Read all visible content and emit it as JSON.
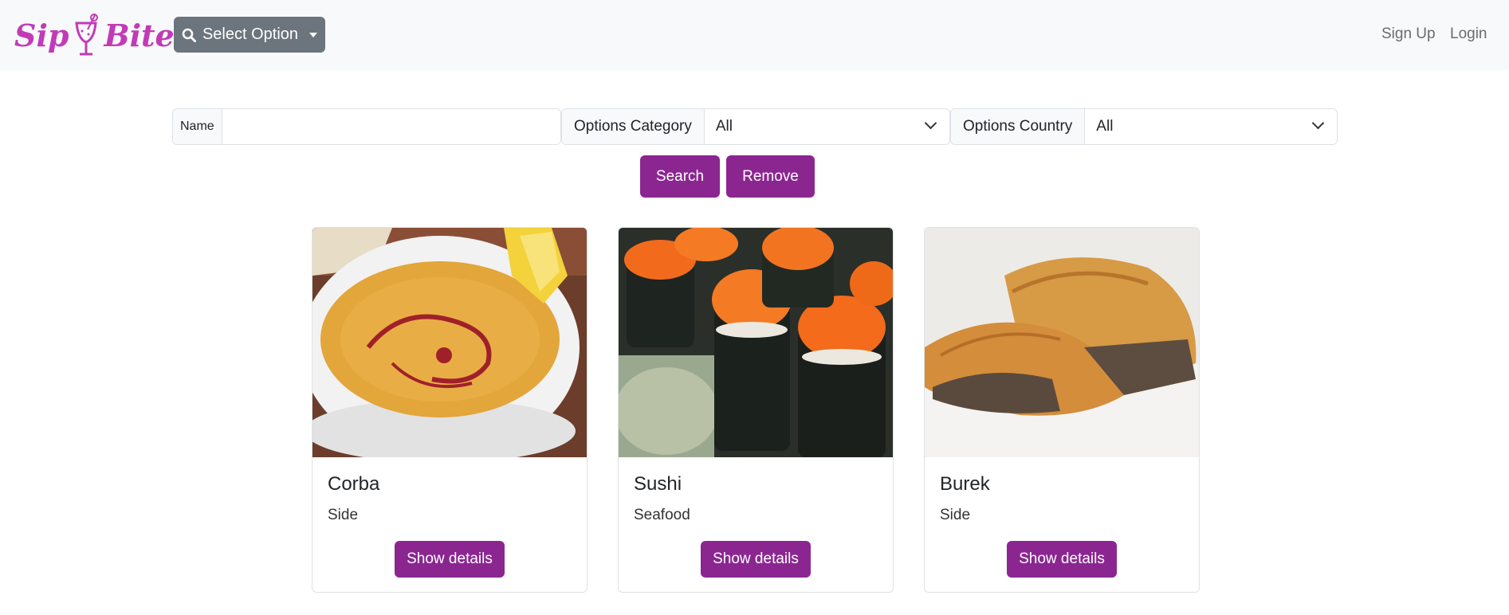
{
  "brand": {
    "part1": "Sip",
    "part2": "Bites"
  },
  "navbar": {
    "select_option_label": "Select Option",
    "signup_label": "Sign Up",
    "login_label": "Login"
  },
  "filters": {
    "name_label": "Name",
    "name_value": "",
    "category_label": "Options Category",
    "category_value": "All",
    "country_label": "Options Country",
    "country_value": "All"
  },
  "actions": {
    "search_label": "Search",
    "remove_label": "Remove"
  },
  "cards": [
    {
      "title": "Corba",
      "category": "Side",
      "button": "Show details",
      "image": "soup-photo"
    },
    {
      "title": "Sushi",
      "category": "Seafood",
      "button": "Show details",
      "image": "sushi-photo"
    },
    {
      "title": "Burek",
      "category": "Side",
      "button": "Show details",
      "image": "burek-photo"
    }
  ],
  "colors": {
    "accent": "#8b2691",
    "brand": "#c13bb6",
    "navbar_bg": "#f8f9fa",
    "dropdown_btn": "#6c757d"
  }
}
